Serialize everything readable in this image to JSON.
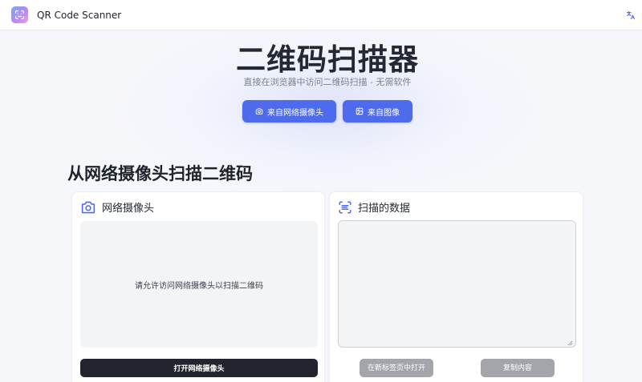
{
  "app": {
    "title": "QR Code Scanner"
  },
  "header": {
    "lang_icon": "translate-icon"
  },
  "hero": {
    "title": "二维码扫描器",
    "subtitle": "直接在浏览器中访问二维码扫描 - 无需软件",
    "btn_webcam": "来自网络摄像头",
    "btn_image": "来自图像"
  },
  "section": {
    "title": "从网络摄像头扫描二维码"
  },
  "webcam_card": {
    "title": "网络摄像头",
    "message": "请允许访问网络摄像头以扫描二维码",
    "open_btn": "打开网络摄像头"
  },
  "data_card": {
    "title": "扫描的数据",
    "textarea_value": "",
    "open_tab_btn": "在新标签页中打开",
    "copy_btn": "复制内容"
  },
  "colors": {
    "accent": "#4f6bed",
    "dark_button": "#22252e",
    "disabled": "#a3a5ab"
  }
}
